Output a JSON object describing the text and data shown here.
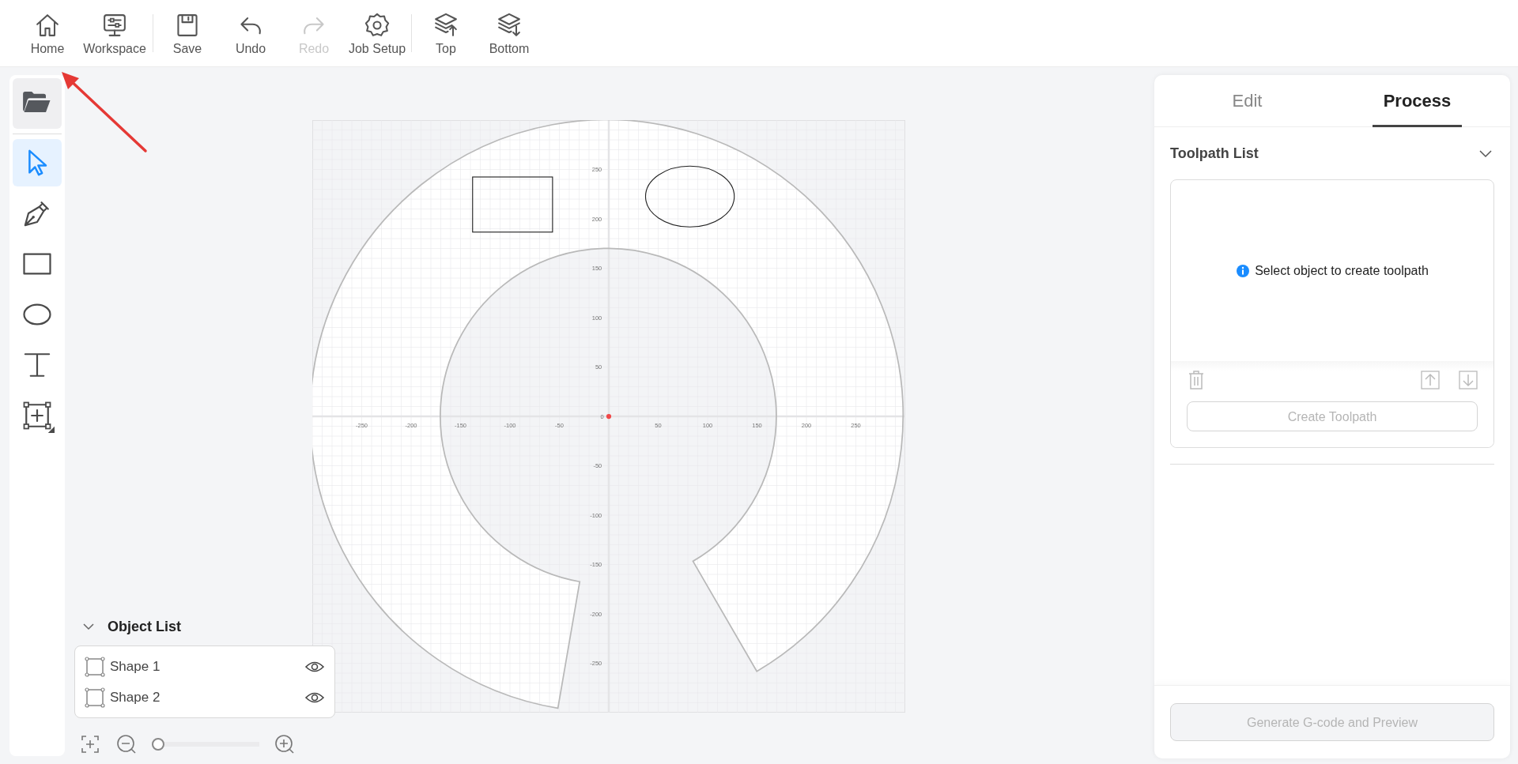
{
  "toolbar": {
    "groups": [
      [
        {
          "kind": "home",
          "label": "Home",
          "disabled": false
        },
        {
          "kind": "workspace",
          "label": "Workspace",
          "disabled": false
        }
      ],
      [
        {
          "kind": "save",
          "label": "Save",
          "disabled": false
        },
        {
          "kind": "undo",
          "label": "Undo",
          "disabled": false
        },
        {
          "kind": "redo",
          "label": "Redo",
          "disabled": true
        },
        {
          "kind": "job-setup",
          "label": "Job Setup",
          "disabled": false
        }
      ],
      [
        {
          "kind": "top",
          "label": "Top",
          "disabled": false
        },
        {
          "kind": "bottom",
          "label": "Bottom",
          "disabled": false
        }
      ]
    ]
  },
  "tool_rail": {
    "items": [
      {
        "kind": "open",
        "selected": false
      },
      {
        "kind": "select",
        "selected": true
      },
      {
        "kind": "pen",
        "selected": false
      },
      {
        "kind": "rectangle",
        "selected": false
      },
      {
        "kind": "ellipse",
        "selected": false
      },
      {
        "kind": "text",
        "selected": false
      },
      {
        "kind": "frame",
        "selected": false
      }
    ]
  },
  "canvas": {
    "origin_label": "0",
    "x_labels": [
      "-250",
      "-200",
      "-150",
      "-100",
      "-50",
      "50",
      "100",
      "150",
      "200",
      "250"
    ],
    "y_labels": [
      "250",
      "200",
      "150",
      "100",
      "50",
      "-50",
      "-100",
      "-150",
      "-200",
      "-250"
    ]
  },
  "object_list": {
    "title": "Object List",
    "expanded": true,
    "items": [
      {
        "name": "Shape 1",
        "visible": true
      },
      {
        "name": "Shape 2",
        "visible": true
      }
    ]
  },
  "zoom": {
    "level": 0
  },
  "side_panel": {
    "tabs": [
      {
        "label": "Edit",
        "selected": false
      },
      {
        "label": "Process",
        "selected": true
      }
    ],
    "toolpath_list": {
      "title": "Toolpath List",
      "expanded": true,
      "empty_message": "Select object to create toolpath",
      "create_button": {
        "label": "Create Toolpath",
        "disabled": true
      }
    },
    "generate_button": {
      "label": "Generate G-code and Preview",
      "disabled": true
    }
  }
}
